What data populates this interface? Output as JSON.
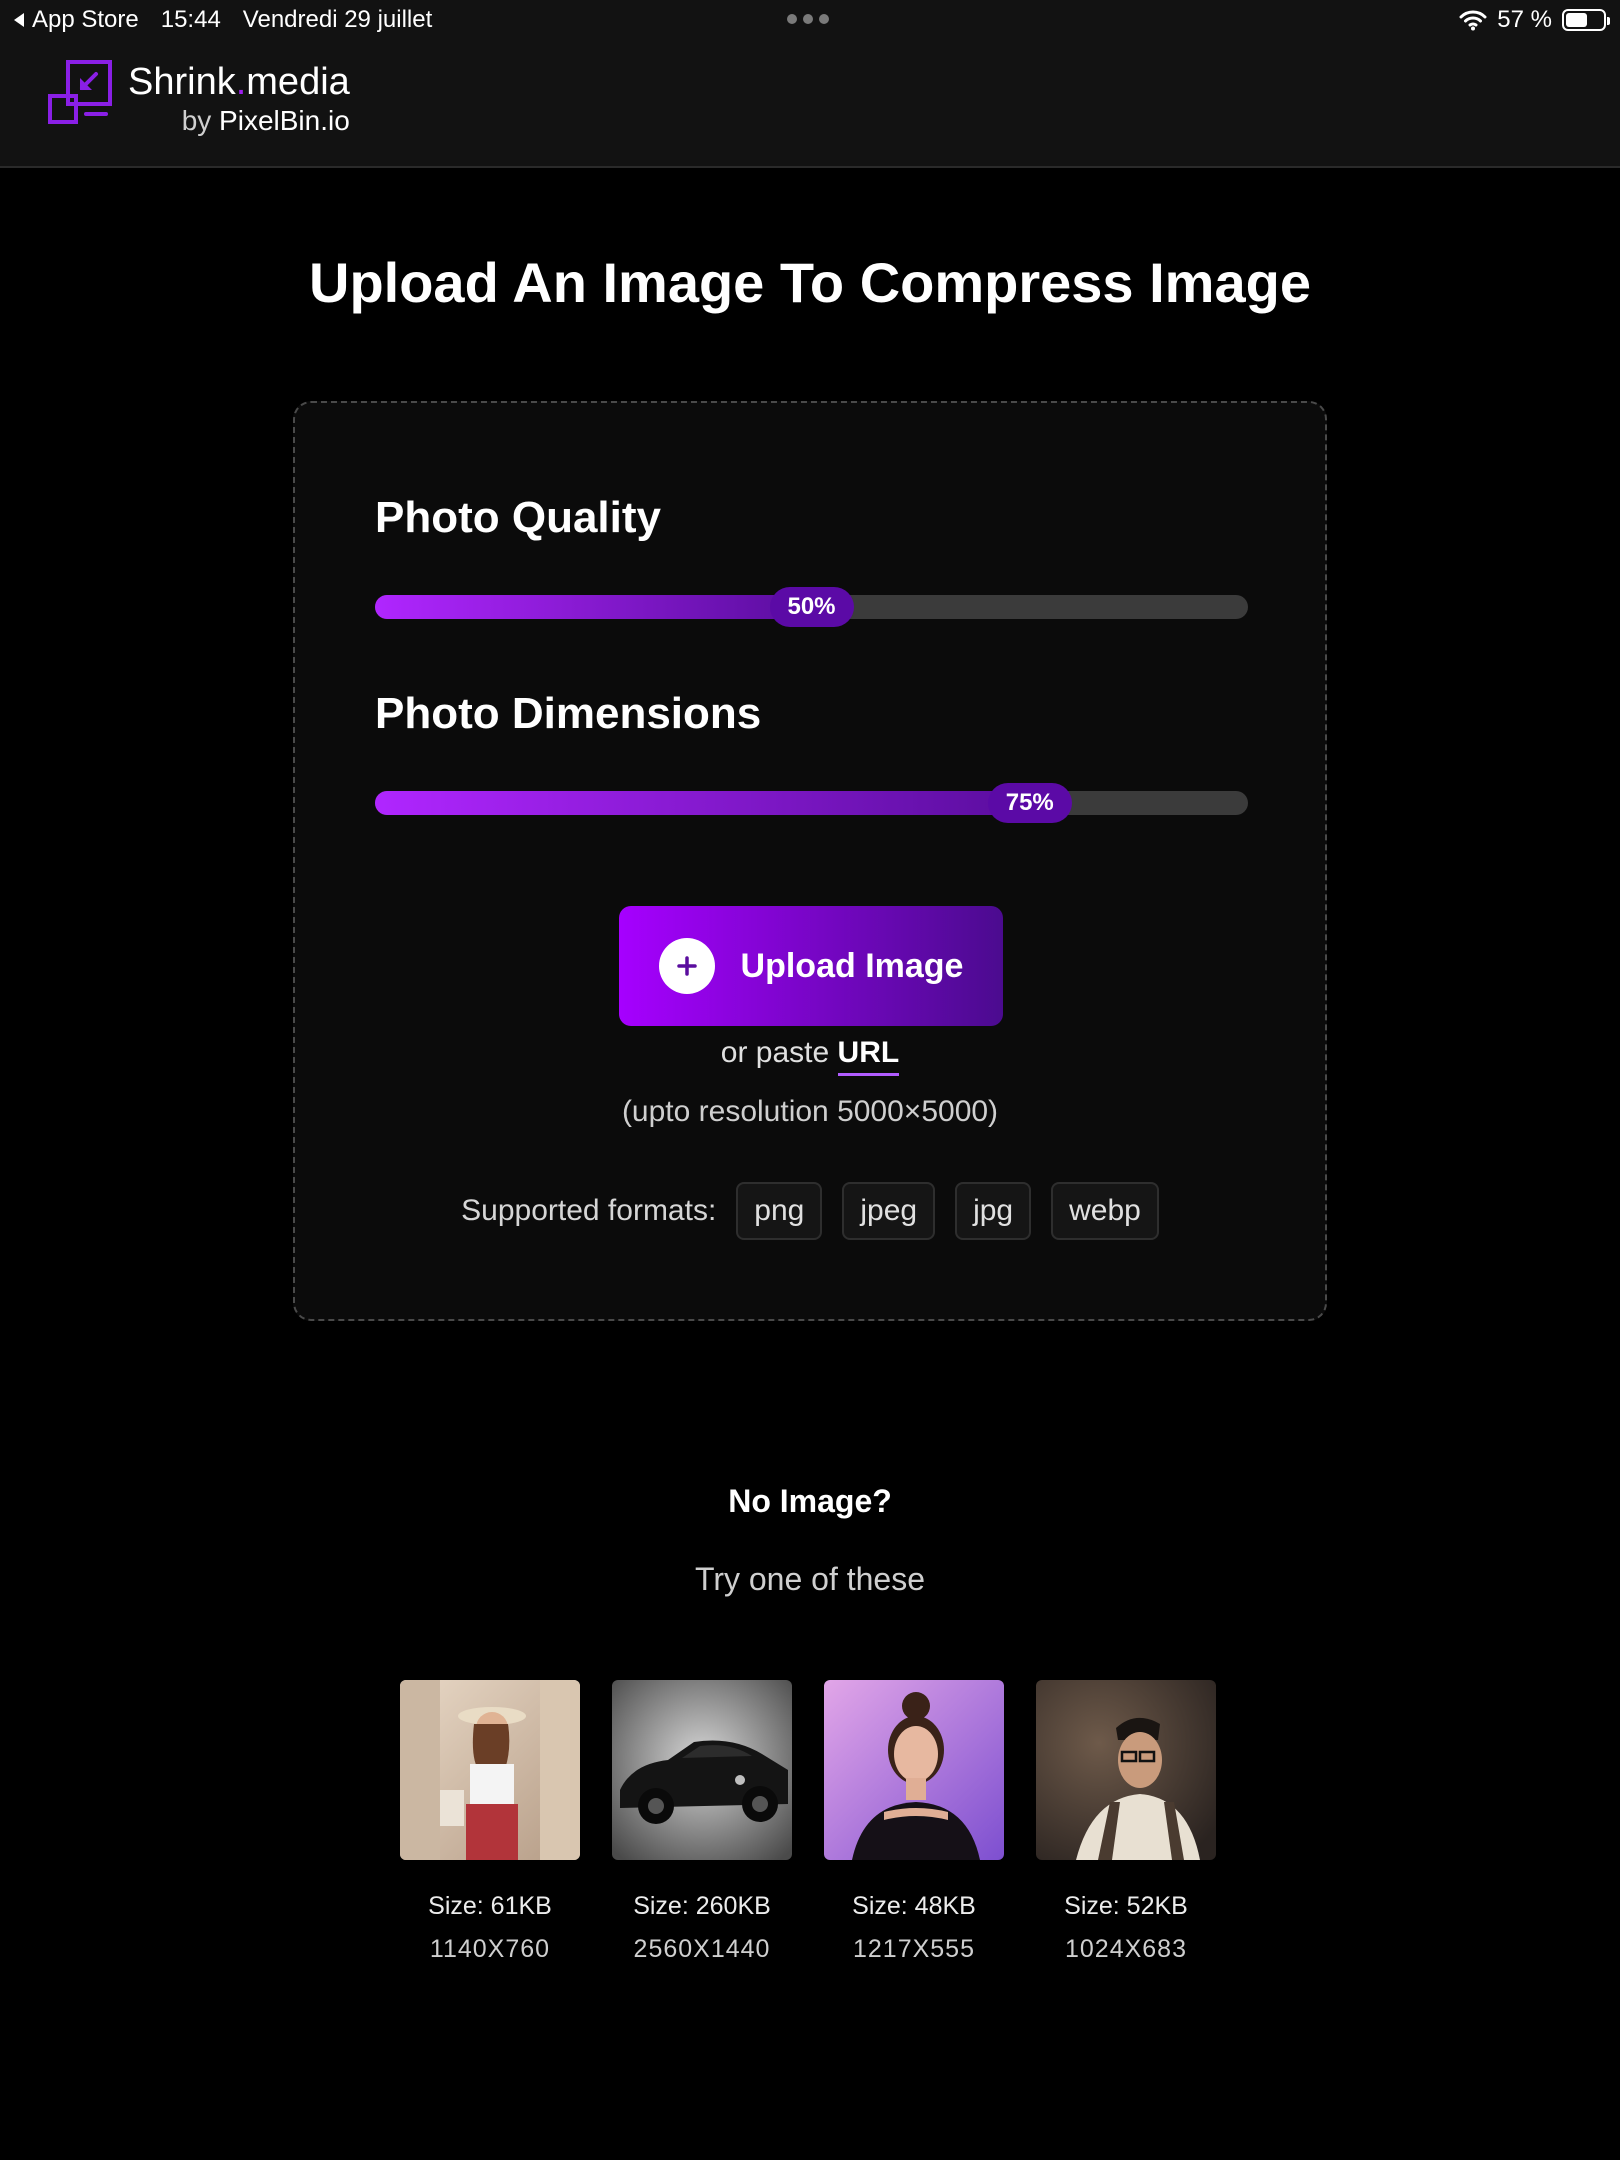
{
  "status_bar": {
    "back_app": "App Store",
    "time": "15:44",
    "date": "Vendredi 29 juillet",
    "battery": "57 %",
    "battery_level": 0.57
  },
  "header": {
    "brand_name": "Shrink",
    "brand_dot": ".",
    "brand_suffix": "media",
    "by_prefix": "by",
    "by_name": "PixelBin.io"
  },
  "main": {
    "title": "Upload An Image To Compress Image"
  },
  "quality": {
    "label": "Photo Quality",
    "value": 0.5,
    "value_text": "50%"
  },
  "dimensions": {
    "label": "Photo Dimensions",
    "value": 0.75,
    "value_text": "75%"
  },
  "upload": {
    "button_label": "Upload Image",
    "paste_prefix": "or paste",
    "paste_link": "URL",
    "resolution_note": "(upto resolution 5000×5000)",
    "formats_label": "Supported formats:",
    "formats": [
      "png",
      "jpeg",
      "jpg",
      "webp"
    ]
  },
  "samples_section": {
    "heading": "No Image?",
    "subheading": "Try one of these",
    "items": [
      {
        "size": "Size: 61KB",
        "dimensions": "1140X760",
        "icon": "woman-with-hat-photo"
      },
      {
        "size": "Size: 260KB",
        "dimensions": "2560X1440",
        "icon": "black-car-photo"
      },
      {
        "size": "Size: 48KB",
        "dimensions": "1217X555",
        "icon": "woman-portrait-photo"
      },
      {
        "size": "Size: 52KB",
        "dimensions": "1024X683",
        "icon": "man-portrait-photo"
      }
    ]
  },
  "colors": {
    "accent": "#a600ff",
    "accent_dark": "#4b0b8f",
    "background": "#000000",
    "card": "#0b0b0b"
  }
}
